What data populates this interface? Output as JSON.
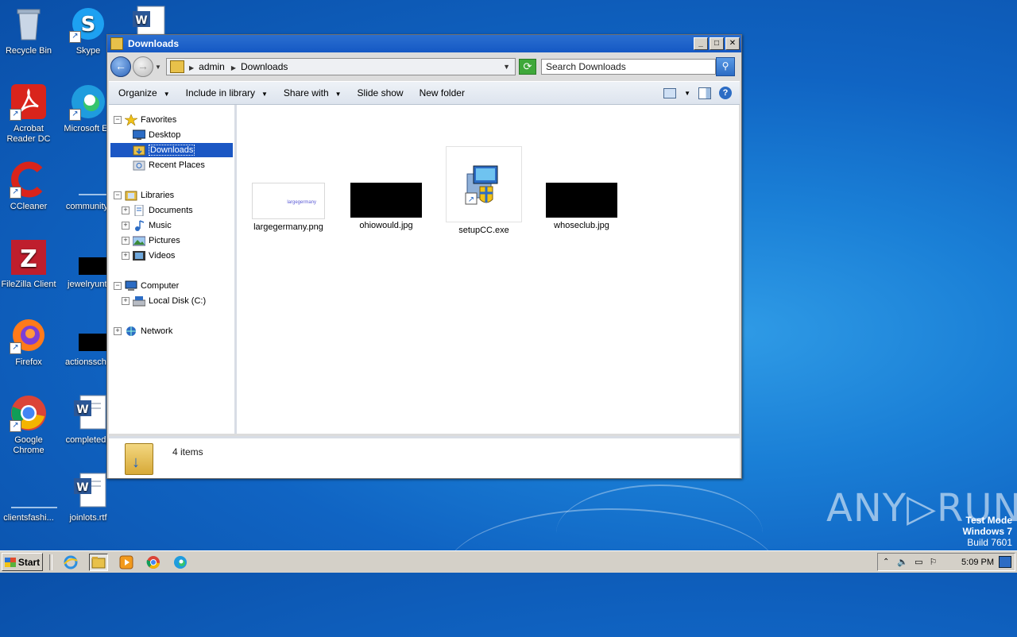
{
  "desktop": {
    "icons": [
      {
        "label": "Recycle Bin"
      },
      {
        "label": "Skype"
      },
      {
        "label": "Acrobat Reader DC"
      },
      {
        "label": "Microsoft Ed"
      },
      {
        "label": "CCleaner"
      },
      {
        "label": "communityt"
      },
      {
        "label": "FileZilla Client"
      },
      {
        "label": "jewelryunti"
      },
      {
        "label": "Firefox"
      },
      {
        "label": "actionsscho"
      },
      {
        "label": "Google Chrome"
      },
      {
        "label": "completedp"
      },
      {
        "label": "clientsfashi..."
      },
      {
        "label": "joinlots.rtf"
      }
    ],
    "watermark": "ANY▷RUN",
    "test_mode": {
      "line1": "Test Mode",
      "line2": "Windows 7",
      "line3": "Build 7601"
    }
  },
  "window": {
    "title": "Downloads",
    "controls": {
      "minimize": "_",
      "maximize": "□",
      "close": "✕"
    },
    "breadcrumb": [
      "admin",
      "Downloads"
    ],
    "search_placeholder": "Search Downloads",
    "toolbar": {
      "organize": "Organize",
      "include": "Include in library",
      "share": "Share with",
      "slideshow": "Slide show",
      "newfolder": "New folder"
    },
    "nav": {
      "favorites": "Favorites",
      "desktop": "Desktop",
      "downloads": "Downloads",
      "recent": "Recent Places",
      "libraries": "Libraries",
      "documents": "Documents",
      "music": "Music",
      "pictures": "Pictures",
      "videos": "Videos",
      "computer": "Computer",
      "localdisk": "Local Disk (C:)",
      "network": "Network"
    },
    "files": [
      {
        "name": "largegermany.png",
        "thumb_text": "largegermany"
      },
      {
        "name": "ohiowould.jpg"
      },
      {
        "name": "setupCC.exe"
      },
      {
        "name": "whoseclub.jpg"
      }
    ],
    "status": "4 items"
  },
  "taskbar": {
    "start": "Start",
    "clock": "5:09 PM"
  },
  "colors": {
    "accent": "#1b57c4",
    "desktop": "#1a7fd6"
  }
}
